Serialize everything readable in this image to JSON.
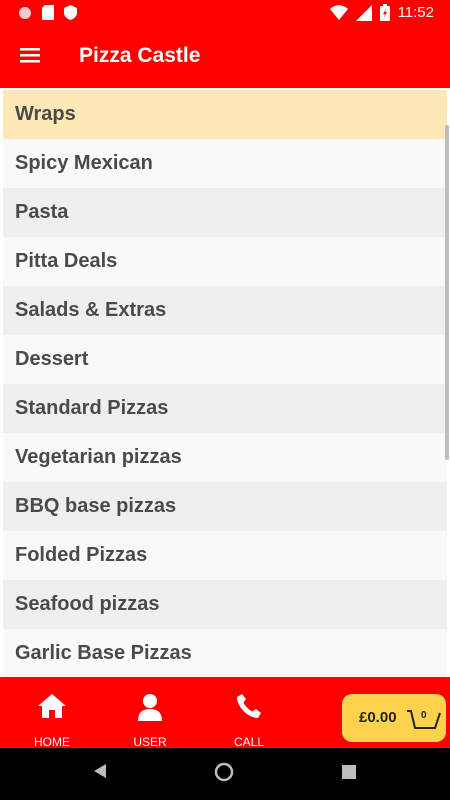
{
  "status_bar": {
    "time": "11:52"
  },
  "app_bar": {
    "title": "Pizza Castle"
  },
  "categories": [
    "Wraps",
    "Spicy Mexican",
    "Pasta",
    "Pitta Deals",
    "Salads & Extras",
    "Dessert",
    "Standard Pizzas",
    "Vegetarian pizzas",
    "BBQ base pizzas",
    "Folded Pizzas",
    "Seafood pizzas",
    "Garlic Base Pizzas"
  ],
  "bottom_nav": {
    "home_label": "HOME",
    "user_label": "USER",
    "call_label": "CALL"
  },
  "cart": {
    "total": "£0.00",
    "count": "0"
  },
  "colors": {
    "primary": "#ff0000",
    "selected_row": "#fde8b6",
    "cart_button": "#ffd24d"
  }
}
